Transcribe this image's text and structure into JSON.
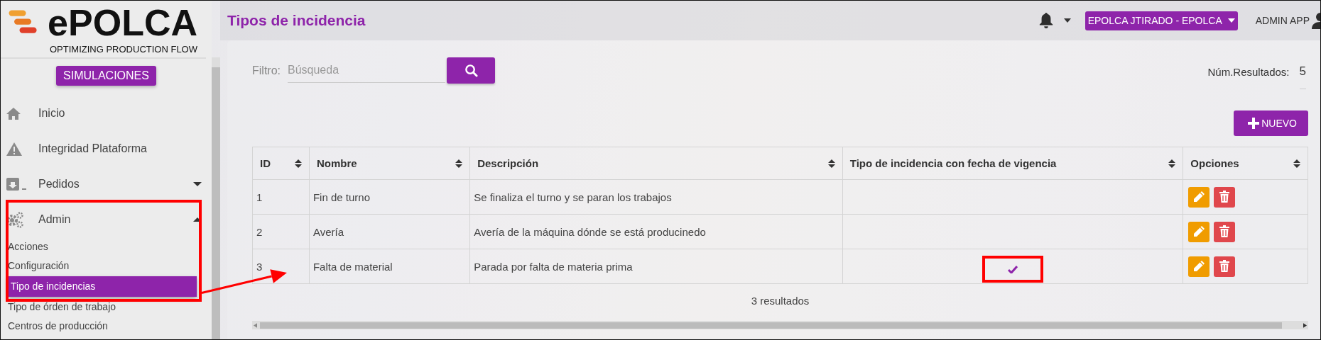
{
  "logo": {
    "name": "ePOLCA",
    "tagline": "OPTIMIZING PRODUCTION FLOW"
  },
  "simulations_button": "SIMULACIONES",
  "sidebar": {
    "items": [
      {
        "label": "Inicio",
        "highlighted": false
      },
      {
        "label": "Integridad Plataforma",
        "highlighted": false
      },
      {
        "label": "Pedidos",
        "expanded": false,
        "highlighted": false
      },
      {
        "label": "Admin",
        "expanded": true,
        "highlighted": true,
        "children": [
          {
            "label": "Acciones",
            "selected": false
          },
          {
            "label": "Configuración",
            "selected": false
          },
          {
            "label": "Tipo de incidencias",
            "selected": true
          },
          {
            "label": "Tipo de órden de trabajo",
            "selected": false
          },
          {
            "label": "Centros de producción",
            "selected": false
          }
        ]
      }
    ]
  },
  "page_title": "Tipos de incidencia",
  "header": {
    "company": "EPOLCA JTIRADO - EPOLCA",
    "user": "ADMIN APP"
  },
  "filter": {
    "label": "Filtro:",
    "placeholder": "Búsqueda"
  },
  "results": {
    "label": "Núm.Resultados:",
    "value": "5"
  },
  "new_button": "NUEVO",
  "table": {
    "columns": [
      {
        "label": "ID",
        "sortable": true
      },
      {
        "label": "Nombre",
        "sortable": true
      },
      {
        "label": "Descripción",
        "sortable": true
      },
      {
        "label": "Tipo de incidencia con fecha de vigencia",
        "sortable": true
      },
      {
        "label": "Opciones",
        "sortable": true
      }
    ],
    "rows": [
      {
        "id": "1",
        "name": "Fin de turno",
        "description": "Se finaliza el turno y se paran los trabajos",
        "with_validity_date": false,
        "highlighted": false
      },
      {
        "id": "2",
        "name": "Avería",
        "description": "Avería de la máquina dónde se está producinedo",
        "with_validity_date": false,
        "highlighted": false
      },
      {
        "id": "3",
        "name": "Falta de material",
        "description": "Parada por falta de materia prima",
        "with_validity_date": true,
        "highlighted": true
      }
    ],
    "footer": "3 resultados"
  }
}
